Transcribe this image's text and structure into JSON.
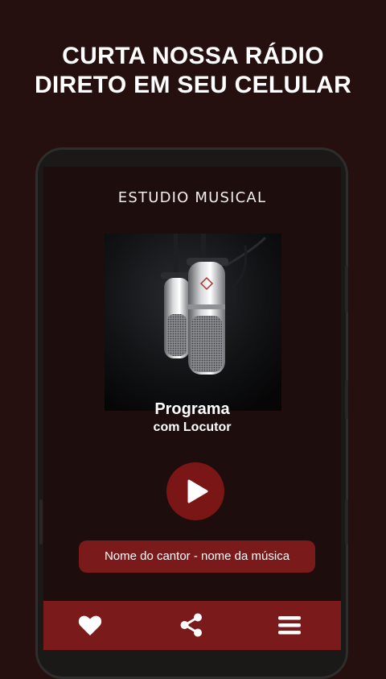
{
  "headline": {
    "line1": "CURTA NOSSA RÁDIO",
    "line2": "DIRETO EM SEU CELULAR"
  },
  "app": {
    "station_name": "ESTUDIO MUSICAL",
    "program": {
      "title": "Programa",
      "subtitle": "com Locutor"
    },
    "now_playing": "Nome do cantor - nome da música",
    "player_state": "paused"
  },
  "bottom_nav": {
    "items": [
      {
        "icon": "heart-icon"
      },
      {
        "icon": "share-icon"
      },
      {
        "icon": "menu-icon"
      }
    ]
  },
  "colors": {
    "background": "#250f0f",
    "screen": "#1d0d0d",
    "accent": "#7a1a1a",
    "text": "#ffffff"
  }
}
